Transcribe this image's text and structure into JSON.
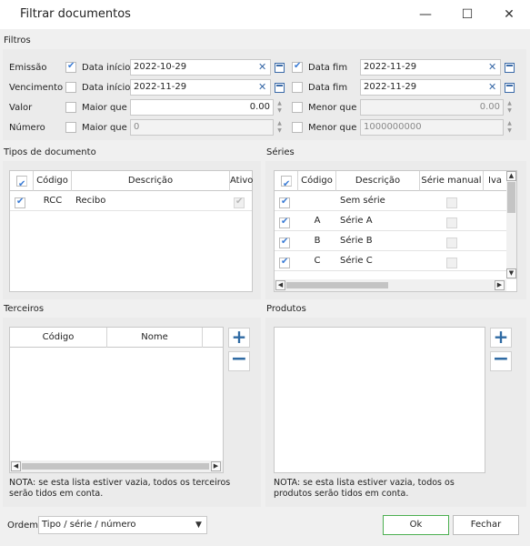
{
  "window": {
    "title": "Filtrar documentos",
    "minimize": "—",
    "maximize": "☐",
    "close": "✕"
  },
  "filters": {
    "section_label": "Filtros",
    "rows": [
      {
        "label": "Emissão",
        "start_checked": true,
        "start_label": "Data início",
        "start_value": "2022-10-29",
        "end_checked": true,
        "end_label": "Data fim",
        "end_value": "2022-11-29"
      },
      {
        "label": "Vencimento",
        "start_checked": false,
        "start_label": "Data início",
        "start_value": "2022-11-29",
        "end_checked": false,
        "end_label": "Data fim",
        "end_value": "2022-11-29"
      },
      {
        "label": "Valor",
        "start_checked": false,
        "start_label": "Maior que",
        "start_value": "0.00",
        "end_checked": false,
        "end_label": "Menor que",
        "end_value": "0.00"
      },
      {
        "label": "Número",
        "start_checked": false,
        "start_label": "Maior que",
        "start_value": "0",
        "end_checked": false,
        "end_label": "Menor que",
        "end_value": "1000000000"
      }
    ]
  },
  "doc_types": {
    "section_label": "Tipos de documento",
    "columns": [
      "Código",
      "Descrição",
      "Ativo"
    ],
    "rows": [
      {
        "checked": true,
        "code": "RCC",
        "description": "Recibo",
        "active": true
      }
    ]
  },
  "series": {
    "section_label": "Séries",
    "columns": [
      "Código",
      "Descrição",
      "Série manual",
      "Iva"
    ],
    "rows": [
      {
        "checked": true,
        "code": "",
        "description": "Sem série",
        "manual": false
      },
      {
        "checked": true,
        "code": "A",
        "description": "Série A",
        "manual": false
      },
      {
        "checked": true,
        "code": "B",
        "description": "Série B",
        "manual": false
      },
      {
        "checked": true,
        "code": "C",
        "description": "Série C",
        "manual": false
      }
    ]
  },
  "third_parties": {
    "section_label": "Terceiros",
    "columns": [
      "Código",
      "Nome"
    ],
    "add": "+",
    "remove": "−",
    "note": "NOTA: se esta lista estiver vazia, todos os terceiros serão tidos em conta."
  },
  "products": {
    "section_label": "Produtos",
    "add": "+",
    "remove": "−",
    "note": "NOTA: se esta lista estiver vazia, todos os produtos serão tidos em conta."
  },
  "footer": {
    "order_label": "Ordem",
    "order_value": "Tipo / série / número",
    "ok": "Ok",
    "close": "Fechar"
  },
  "colors": {
    "accent": "#3a7bd5",
    "ok_border": "#4caf50"
  }
}
